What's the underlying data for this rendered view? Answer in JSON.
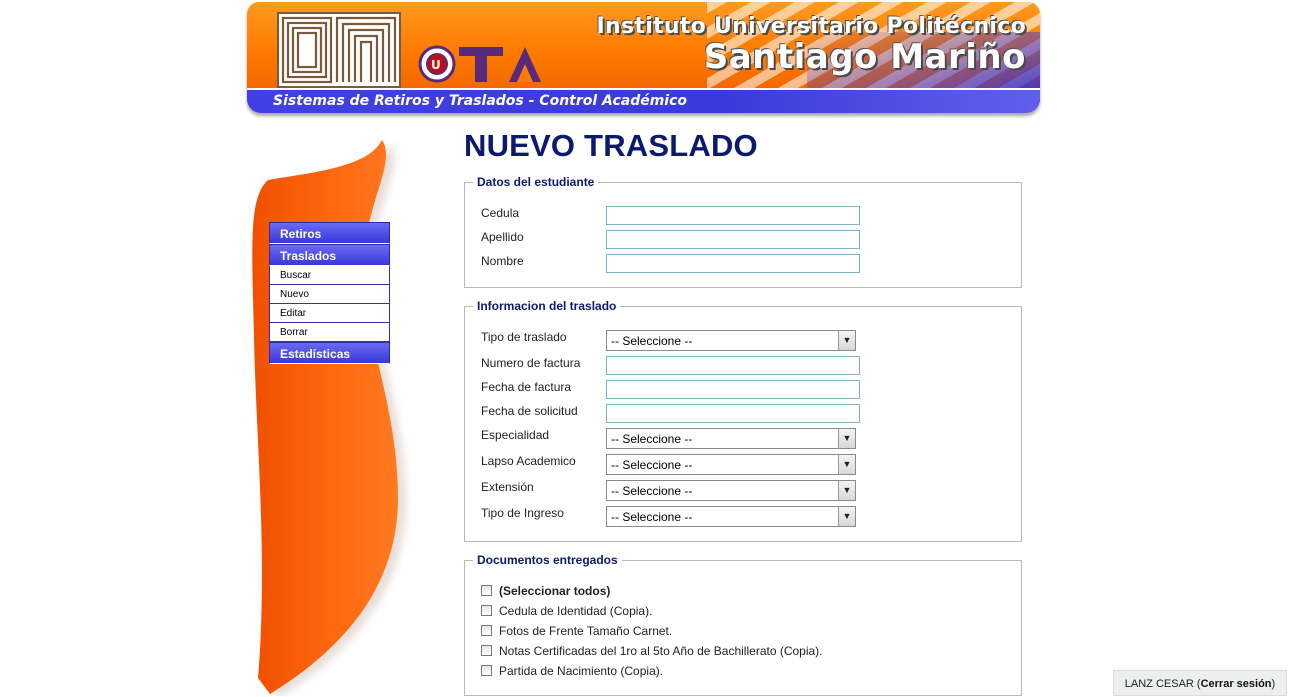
{
  "banner": {
    "institute_line1": "Instituto Universitario Politécnico",
    "institute_line2": "Santiago Mariño",
    "subtitle": "Sistemas de Retiros y Traslados - Control Académico"
  },
  "menu": {
    "sections": [
      {
        "label": "Retiros"
      },
      {
        "label": "Traslados"
      },
      {
        "label": "Estadísticas"
      }
    ],
    "traslados_items": [
      {
        "label": "Buscar"
      },
      {
        "label": "Nuevo"
      },
      {
        "label": "Editar"
      },
      {
        "label": "Borrar"
      }
    ]
  },
  "page": {
    "title": "NUEVO TRASLADO"
  },
  "student": {
    "legend": "Datos del estudiante",
    "fields": [
      {
        "label": "Cedula",
        "value": ""
      },
      {
        "label": "Apellido",
        "value": ""
      },
      {
        "label": "Nombre",
        "value": ""
      }
    ]
  },
  "transfer": {
    "legend": "Informacion del traslado",
    "tipo_traslado": {
      "label": "Tipo de traslado",
      "value": "-- Seleccione --"
    },
    "numero_factura": {
      "label": "Numero de factura",
      "value": ""
    },
    "fecha_factura": {
      "label": "Fecha de factura",
      "value": ""
    },
    "fecha_solicitud": {
      "label": "Fecha de solicitud",
      "value": ""
    },
    "especialidad": {
      "label": "Especialidad",
      "value": "-- Seleccione --"
    },
    "lapso": {
      "label": "Lapso Academico",
      "value": "-- Seleccione --"
    },
    "extension": {
      "label": "Extensión",
      "value": "-- Seleccione --"
    },
    "tipo_ingreso": {
      "label": "Tipo de Ingreso",
      "value": "-- Seleccione --"
    }
  },
  "documents": {
    "legend": "Documentos entregados",
    "select_all": "(Seleccionar todos)",
    "items": [
      {
        "label": "Cedula de Identidad (Copia).",
        "checked": false
      },
      {
        "label": "Fotos de Frente Tamaño Carnet.",
        "checked": false
      },
      {
        "label": "Notas Certificadas del 1ro al 5to Año de Bachillerato (Copia).",
        "checked": false
      },
      {
        "label": "Partida de Nacimiento (Copia).",
        "checked": false
      }
    ]
  },
  "user": {
    "name": "LANZ CESAR",
    "logout": "Cerrar sesión"
  },
  "colors": {
    "brand_orange": "#ff7a00",
    "brand_blue": "#3838dc",
    "title_navy": "#0b1a6e"
  }
}
